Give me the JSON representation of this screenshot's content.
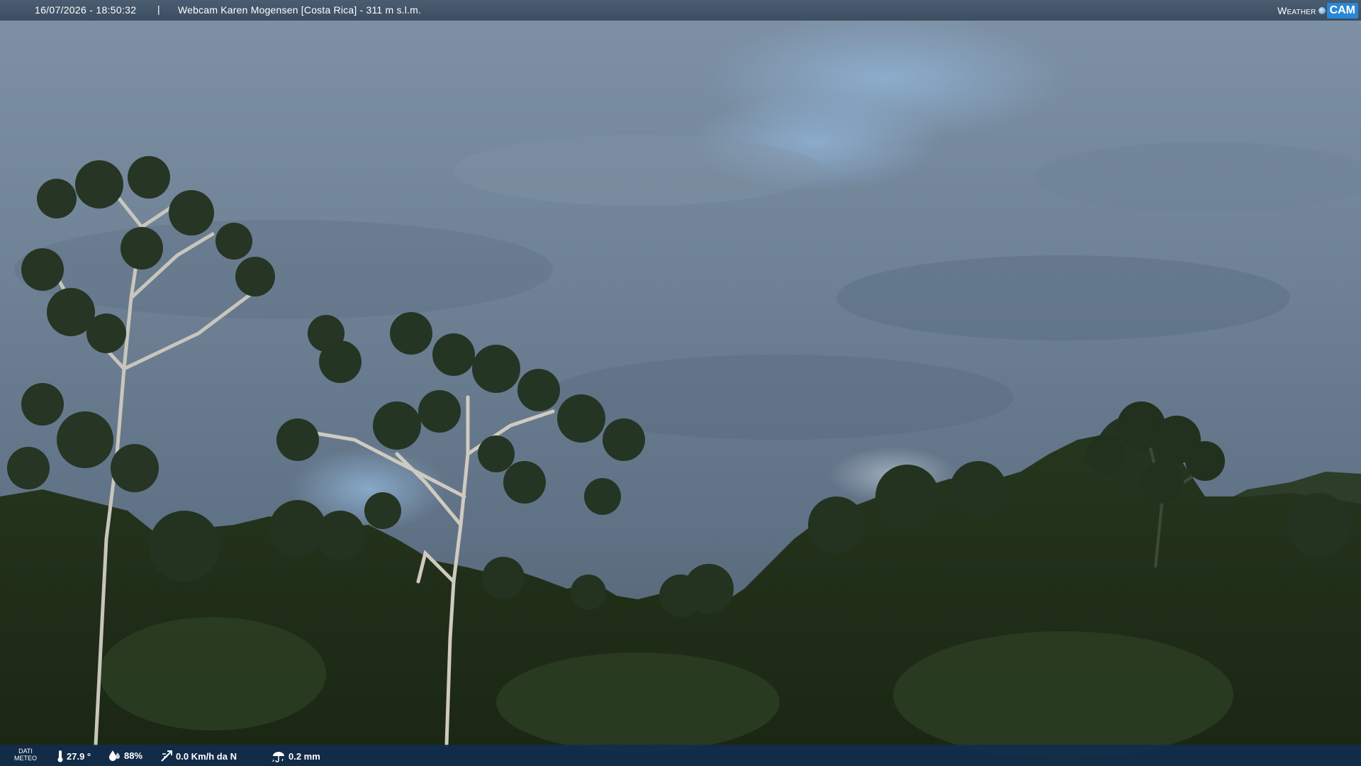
{
  "header": {
    "datetime": "16/07/2026 - 18:50:32",
    "separator": "|",
    "camera": "Webcam Karen Mogensen [Costa Rica]  - 311 m s.l.m.",
    "logo_weather": "Weather",
    "logo_cam": "CAM"
  },
  "footer": {
    "label_line1": "DATI",
    "label_line2": "METEO",
    "temperature": "27.9 °",
    "humidity": "88%",
    "wind": "0.0 Km/h da N",
    "rain": "0.2 mm"
  },
  "icons": {
    "temperature": "thermometer-icon",
    "humidity": "humidity-icon",
    "wind": "wind-icon",
    "rain": "rain-icon"
  },
  "colors": {
    "brand_blue": "#2a86d8",
    "footer_bg": "#122c4e"
  }
}
